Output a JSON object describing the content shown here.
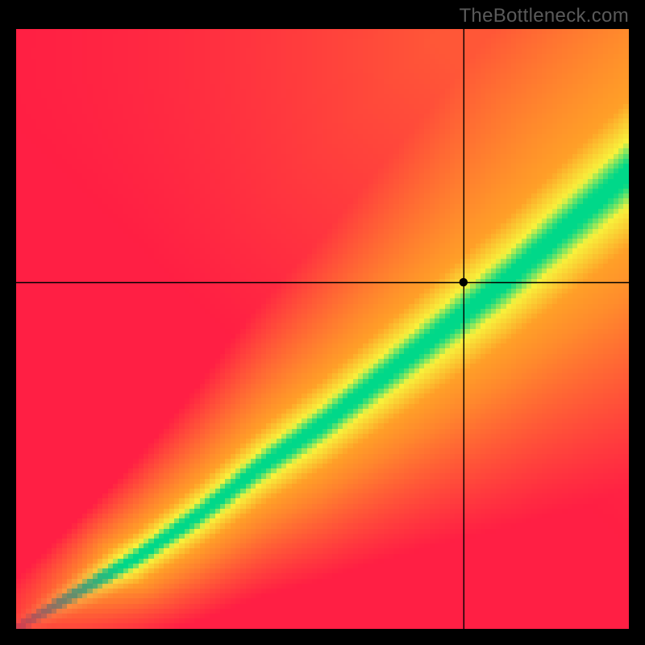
{
  "watermark": "TheBottleneck.com",
  "chart_data": {
    "type": "heatmap",
    "title": "",
    "xlabel": "",
    "ylabel": "",
    "xlim": [
      0,
      100
    ],
    "ylim": [
      0,
      100
    ],
    "description": "Bottleneck field: diagonal green band where x and y scores are balanced; red where severely mismatched; orange/yellow transitional.",
    "marker": {
      "x": 73.0,
      "y": 57.8
    },
    "crosshair": {
      "x": 73.0,
      "y": 57.8
    },
    "band": {
      "center": [
        {
          "x": 0,
          "y": 0
        },
        {
          "x": 10,
          "y": 6
        },
        {
          "x": 20,
          "y": 12
        },
        {
          "x": 30,
          "y": 19
        },
        {
          "x": 40,
          "y": 27
        },
        {
          "x": 50,
          "y": 34
        },
        {
          "x": 60,
          "y": 42
        },
        {
          "x": 70,
          "y": 50
        },
        {
          "x": 80,
          "y": 58
        },
        {
          "x": 90,
          "y": 67
        },
        {
          "x": 100,
          "y": 76
        }
      ],
      "half_width_start": 2,
      "half_width_end": 10
    },
    "colors": {
      "green": "#00d889",
      "yellow": "#f8f23c",
      "orange": "#ffa028",
      "red": "#ff1f44",
      "top_right": "#ffc63a"
    },
    "grid_resolution": 120
  }
}
